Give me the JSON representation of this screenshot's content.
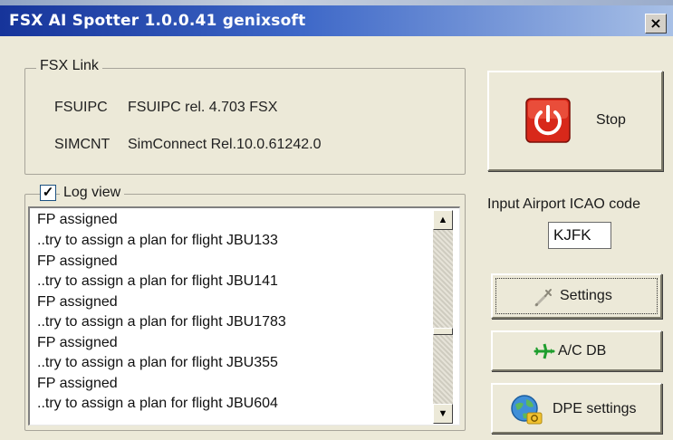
{
  "window": {
    "title": "FSX AI Spotter 1.0.0.41 genixsoft",
    "close_glyph": "×"
  },
  "fsx_link": {
    "legend": "FSX Link",
    "rows": [
      {
        "key": "FSUIPC",
        "value": "FSUIPC rel. 4.703  FSX"
      },
      {
        "key": "SIMCNT",
        "value": "SimConnect Rel.10.0.61242.0"
      }
    ]
  },
  "log_view": {
    "legend": "Log view",
    "checked": true,
    "check_glyph": "✓",
    "lines": [
      "FP assigned",
      "..try to assign a plan for flight JBU133",
      "FP assigned",
      "..try to assign a plan for flight JBU141",
      "FP assigned",
      "..try to assign a plan for flight JBU1783",
      "FP assigned",
      "..try to assign a plan for flight JBU355",
      "FP assigned",
      "..try to assign a plan for flight JBU604"
    ],
    "scroll_up_glyph": "▲",
    "scroll_down_glyph": "▼"
  },
  "buttons": {
    "stop": {
      "label": "Stop",
      "icon": "power-icon",
      "color": "#d8281a"
    },
    "settings": {
      "label": "Settings",
      "icon": "wrench-icon"
    },
    "ac_db": {
      "label": "A/C DB",
      "icon": "airplane-icon",
      "color": "#1f9e2e"
    },
    "dpe_settings": {
      "label": "DPE settings",
      "icon": "globe-icon"
    }
  },
  "airport": {
    "label": "Input Airport ICAO code",
    "value": "KJFK"
  }
}
